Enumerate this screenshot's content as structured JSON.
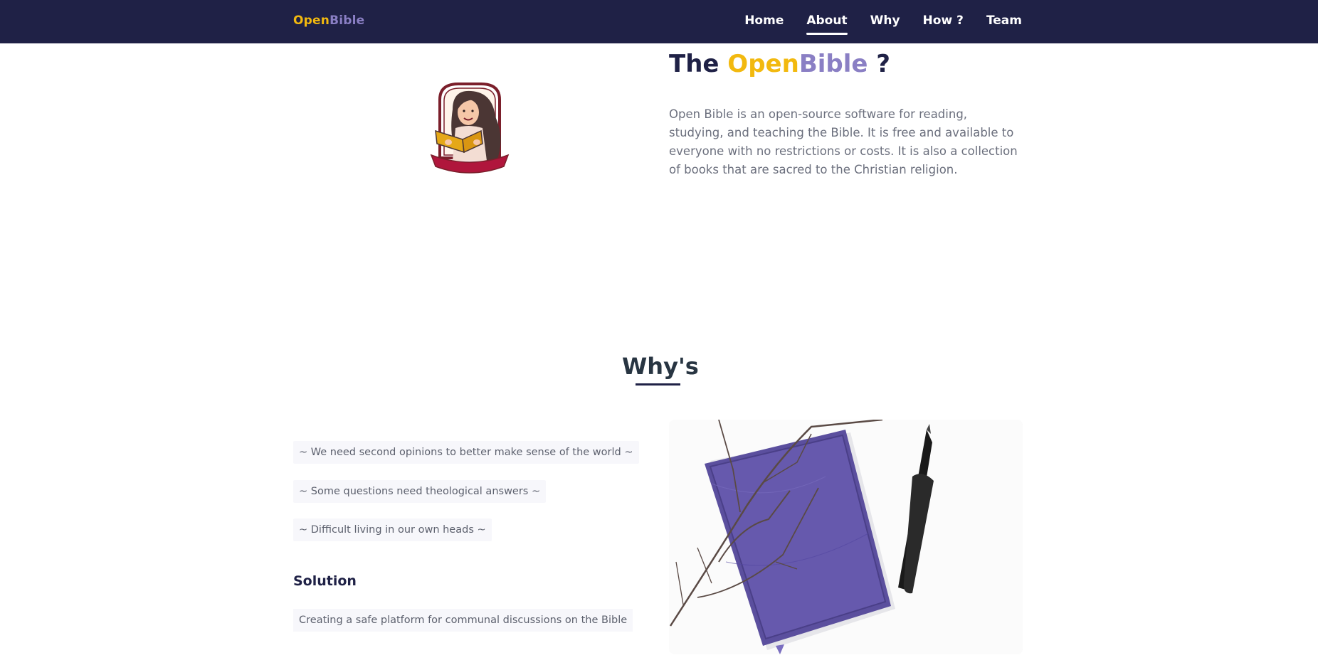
{
  "navbar": {
    "brand_open": "Open",
    "brand_bible": "Bible",
    "links": [
      "Home",
      "About",
      "Why",
      "How ?",
      "Team"
    ],
    "active": "About",
    "bg_color": "#1f2146"
  },
  "about": {
    "title_prefix": "The ",
    "title_open": "Open",
    "title_bible": "Bible",
    "title_suffix": " ?",
    "text": "Open Bible is an open-source software for reading, studying, and teaching the Bible. It is free and available to everyone with no restrictions or costs. It is also a collection of books that are sacred to the Christian religion."
  },
  "whys": {
    "title": "Why's",
    "reasons": [
      "~ We need second opinions to better make sense of the world ~",
      "~ Some questions need theological answers ~",
      "~ Difficult living in our own heads ~"
    ],
    "solution_title": "Solution",
    "solution_text": "Creating a safe platform for communal discussions on the Bible"
  },
  "colors": {
    "accent_yellow": "#f2b90f",
    "accent_purple": "#8a7fc4",
    "dark_navy": "#1f2146"
  }
}
